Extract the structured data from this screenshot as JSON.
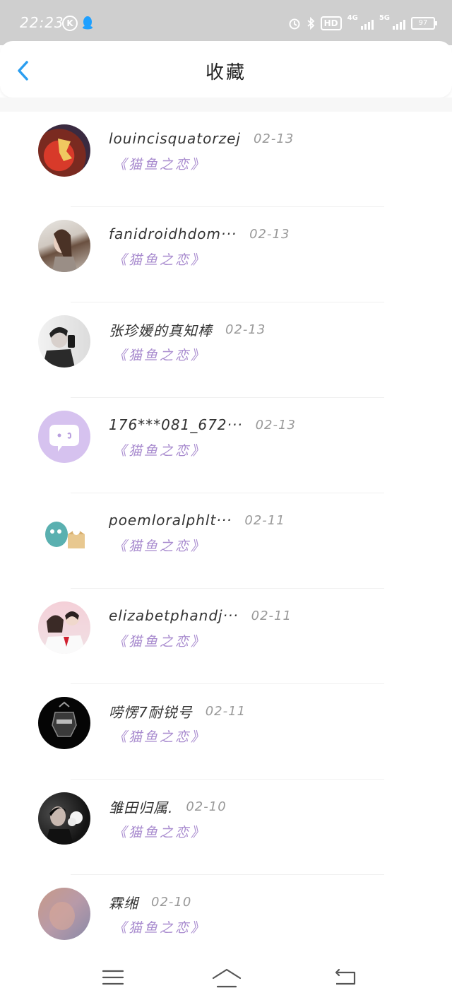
{
  "status_bar": {
    "time": "22:23",
    "k_badge": "K",
    "hd_label": "HD",
    "net1": "4G",
    "net2": "5G",
    "battery": "97"
  },
  "header": {
    "title": "收藏"
  },
  "favorites": [
    {
      "name": "louincisquatorzej",
      "date": "02-13",
      "book": "《猫鱼之恋》"
    },
    {
      "name": "fanidroidhdom···",
      "date": "02-13",
      "book": "《猫鱼之恋》"
    },
    {
      "name": "张珍媛的真知棒",
      "date": "02-13",
      "book": "《猫鱼之恋》"
    },
    {
      "name": "176***081_672···",
      "date": "02-13",
      "book": "《猫鱼之恋》"
    },
    {
      "name": "poemloralphlt···",
      "date": "02-11",
      "book": "《猫鱼之恋》"
    },
    {
      "name": "elizabetphandj···",
      "date": "02-11",
      "book": "《猫鱼之恋》"
    },
    {
      "name": "唠愣7耐锐号",
      "date": "02-11",
      "book": "《猫鱼之恋》"
    },
    {
      "name": "雏田归属.",
      "date": "02-10",
      "book": "《猫鱼之恋》"
    },
    {
      "name": "霖缃",
      "date": "02-10",
      "book": "《猫鱼之恋》"
    }
  ],
  "colors": {
    "accent": "#2b9ef0",
    "book_title": "#a98ccf",
    "status_bar": "#cfcfcf"
  },
  "icons": {
    "back": "chevron-left-icon",
    "menu": "menu-icon",
    "home": "home-icon",
    "return": "return-icon"
  }
}
